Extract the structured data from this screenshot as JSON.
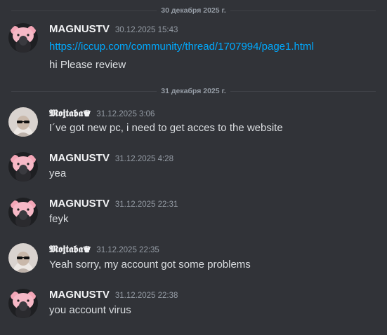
{
  "dividers": [
    {
      "label": "30 декабря 2025 г."
    },
    {
      "label": "31 декабря 2025 г."
    }
  ],
  "messages": [
    {
      "author": "MAGNUSTV",
      "timestamp": "30.12.2025 15:43",
      "avatar_icon": "pink-bear-avatar-icon",
      "lines": [
        {
          "text": "https://iccup.com/community/thread/1707994/page1.html",
          "type": "link"
        },
        {
          "text": "hi Please review",
          "type": "text"
        }
      ]
    },
    {
      "author": "𝕸𝖔𝖏𝖙𝖆𝖇𝖆♛",
      "timestamp": "31.12.2025 3:06",
      "avatar_icon": "sunglasses-person-avatar-icon",
      "lines": [
        {
          "text": "I´ve got new pc, i need to get acces to the website",
          "type": "text"
        }
      ]
    },
    {
      "author": "MAGNUSTV",
      "timestamp": "31.12.2025 4:28",
      "avatar_icon": "pink-bear-avatar-icon",
      "lines": [
        {
          "text": "yea",
          "type": "text"
        }
      ]
    },
    {
      "author": "MAGNUSTV",
      "timestamp": "31.12.2025 22:31",
      "avatar_icon": "pink-bear-avatar-icon",
      "lines": [
        {
          "text": "feyk",
          "type": "text"
        }
      ]
    },
    {
      "author": "𝕸𝖔𝖏𝖙𝖆𝖇𝖆♛",
      "timestamp": "31.12.2025 22:35",
      "avatar_icon": "sunglasses-person-avatar-icon",
      "lines": [
        {
          "text": "Yeah sorry, my account got some problems",
          "type": "text"
        }
      ]
    },
    {
      "author": "MAGNUSTV",
      "timestamp": "31.12.2025 22:38",
      "avatar_icon": "pink-bear-avatar-icon",
      "lines": [
        {
          "text": "you account virus",
          "type": "text"
        }
      ]
    }
  ],
  "colors": {
    "background": "#313338",
    "link": "#00a8fc",
    "username": "#f2f3f5",
    "text": "#dbdee1",
    "muted": "#949ba4"
  }
}
